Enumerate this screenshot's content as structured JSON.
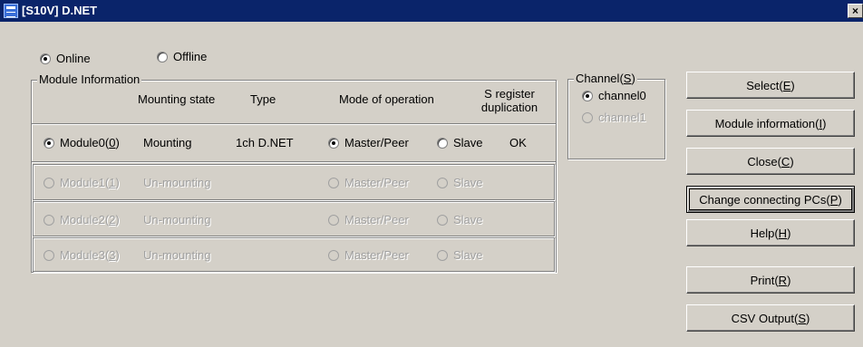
{
  "window": {
    "title": "[S10V] D.NET",
    "close_label": "×"
  },
  "mode": {
    "online_label": "Online",
    "offline_label": "Offline",
    "selected": "Online"
  },
  "module_info": {
    "legend": "Module Information",
    "headers": {
      "mounting_state": "Mounting state",
      "type": "Type",
      "mode_of_operation": "Mode of operation",
      "s_register_line1": "S register",
      "s_register_line2": "duplication"
    },
    "modules": [
      {
        "name": "Module0",
        "key": "0",
        "mounting": "Mounting",
        "type": "1ch D.NET",
        "master_label": "Master/Peer",
        "slave_label": "Slave",
        "s_register": "OK",
        "selected": true,
        "mode_selected": "Master/Peer",
        "enabled": true
      },
      {
        "name": "Module1",
        "key": "1",
        "mounting": "Un-mounting",
        "type": "",
        "master_label": "Master/Peer",
        "slave_label": "Slave",
        "s_register": "",
        "selected": false,
        "mode_selected": "",
        "enabled": false
      },
      {
        "name": "Module2",
        "key": "2",
        "mounting": "Un-mounting",
        "type": "",
        "master_label": "Master/Peer",
        "slave_label": "Slave",
        "s_register": "",
        "selected": false,
        "mode_selected": "",
        "enabled": false
      },
      {
        "name": "Module3",
        "key": "3",
        "mounting": "Un-mounting",
        "type": "",
        "master_label": "Master/Peer",
        "slave_label": "Slave",
        "s_register": "",
        "selected": false,
        "mode_selected": "",
        "enabled": false
      }
    ]
  },
  "channel": {
    "legend_text": "Channel",
    "legend_key": "S",
    "items": [
      {
        "label": "channel0",
        "selected": true,
        "enabled": true
      },
      {
        "label": "channel1",
        "selected": false,
        "enabled": false
      }
    ]
  },
  "buttons": {
    "select": {
      "text": "Select",
      "key": "E"
    },
    "module_information": {
      "text": "Module information",
      "key": "I"
    },
    "close": {
      "text": "Close",
      "key": "C"
    },
    "change_pcs": {
      "text": "Change connecting PCs",
      "key": "P"
    },
    "help": {
      "text": "Help",
      "key": "H"
    },
    "print": {
      "text": "Print",
      "key": "R"
    },
    "csv_output": {
      "text": "CSV Output ",
      "key": "S"
    }
  },
  "colors": {
    "titlebar": "#0a246a",
    "dialog_bg": "#d4d0c8",
    "disabled_text": "#a0a0a0"
  }
}
